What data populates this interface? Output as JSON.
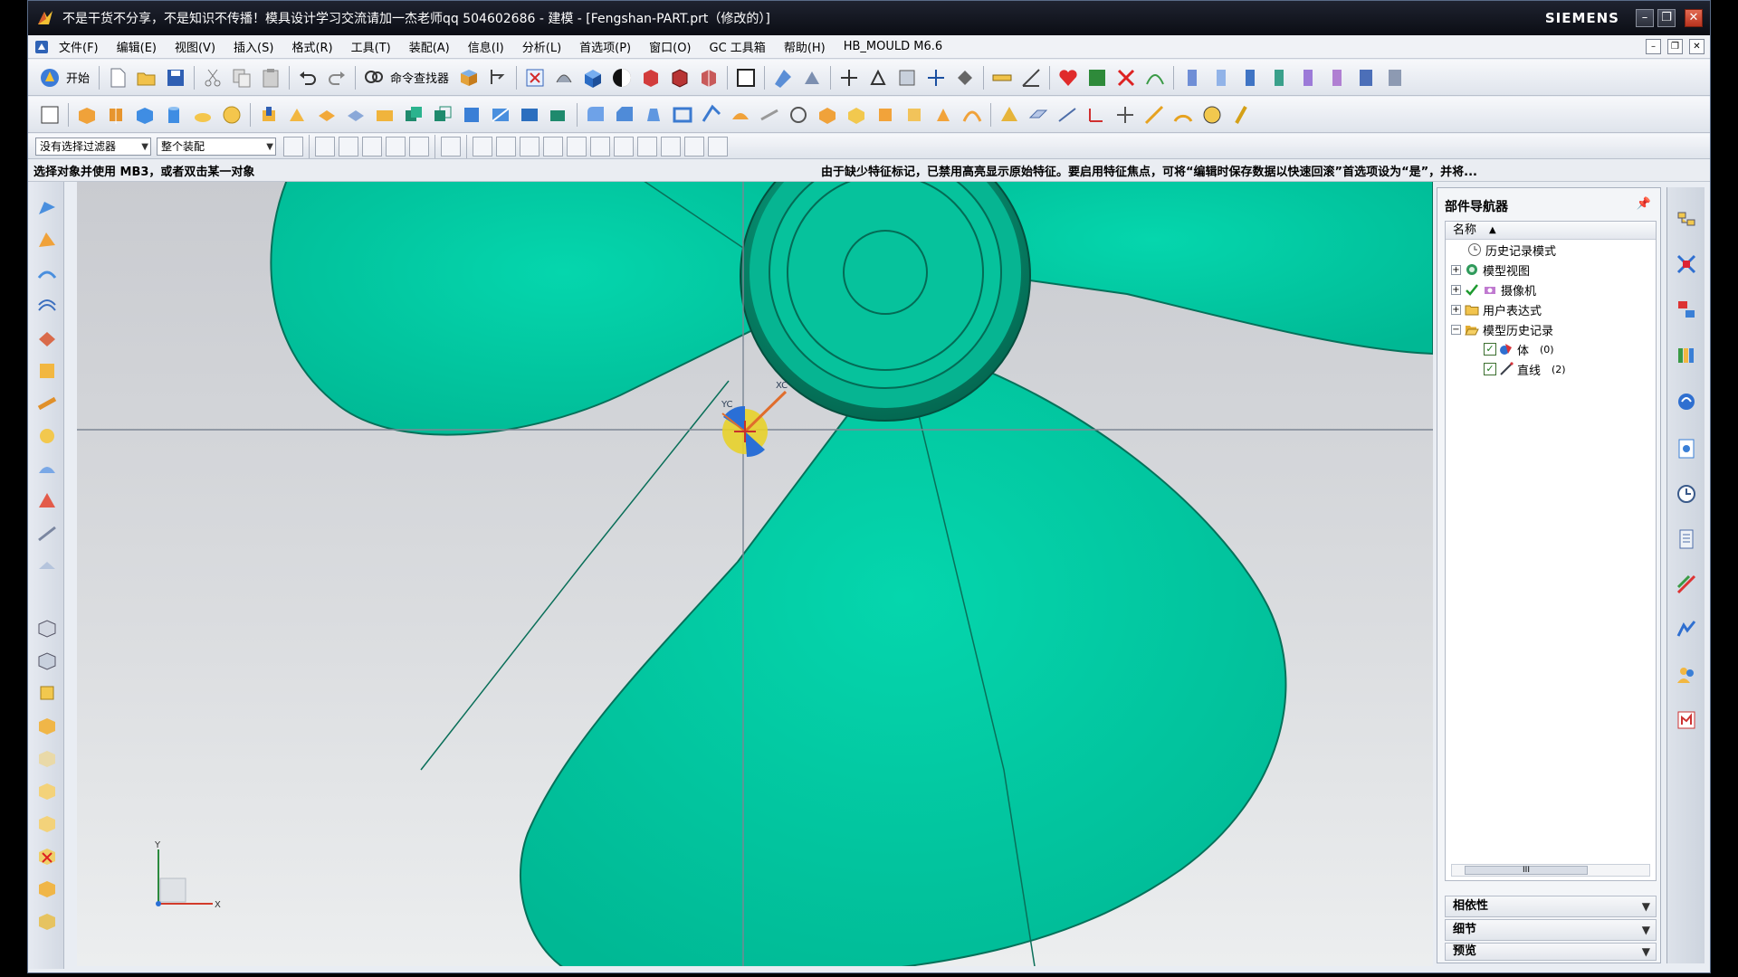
{
  "window": {
    "title": "不是干货不分享，不是知识不传播！模具设计学习交流请加一杰老师qq 504602686 - 建模 - [Fengshan-PART.prt（修改的）]",
    "brand": "SIEMENS",
    "buttons": [
      "–",
      "❐",
      "✕"
    ]
  },
  "menu": {
    "items": [
      "文件(F)",
      "编辑(E)",
      "视图(V)",
      "插入(S)",
      "格式(R)",
      "工具(T)",
      "装配(A)",
      "信息(I)",
      "分析(L)",
      "首选项(P)",
      "窗口(O)",
      "GC 工具箱",
      "帮助(H)",
      "HB_MOULD M6.6"
    ],
    "doc_buttons": [
      "–",
      "❐",
      "✕"
    ]
  },
  "toolbar": {
    "start_label": "开始",
    "command_finder_label": "命令查找器"
  },
  "selection_bar": {
    "filter_value": "没有选择过滤器",
    "scope_value": "整个装配"
  },
  "status": {
    "prompt": "选择对象并使用 MB3，或者双击某一对象",
    "message": "由于缺少特征标记，已禁用高亮显示原始特征。要启用特征焦点，可将“编辑时保存数据以快速回滚”首选项设为“是”，并将..."
  },
  "viewport": {
    "csys_labels": {
      "x": "X",
      "y": "Y",
      "xc": "XC",
      "yc": "YC"
    },
    "colors": {
      "part": "#00c7a0",
      "part_dark": "#00a985",
      "hub_dark": "#05664f",
      "background": "#d4d6da"
    }
  },
  "navigator": {
    "title": "部件导航器",
    "column_header": "名称",
    "tree": [
      {
        "label": "历史记录模式",
        "icon": "clock-icon",
        "expand": ""
      },
      {
        "label": "模型视图",
        "icon": "model-views-icon",
        "expand": "+"
      },
      {
        "label": "摄像机",
        "icon": "camera-icon",
        "expand": "+"
      },
      {
        "label": "用户表达式",
        "icon": "folder-icon",
        "expand": "+"
      },
      {
        "label": "模型历史记录",
        "icon": "folder-open-icon",
        "expand": "−"
      },
      {
        "label": "体",
        "count": "(0)",
        "icon": "body-icon",
        "checked": true
      },
      {
        "label": "直线",
        "count": "(2)",
        "icon": "line-icon",
        "checked": true
      }
    ],
    "scroll_thumb": "III",
    "panels": [
      "相依性",
      "细节",
      "预览"
    ]
  }
}
